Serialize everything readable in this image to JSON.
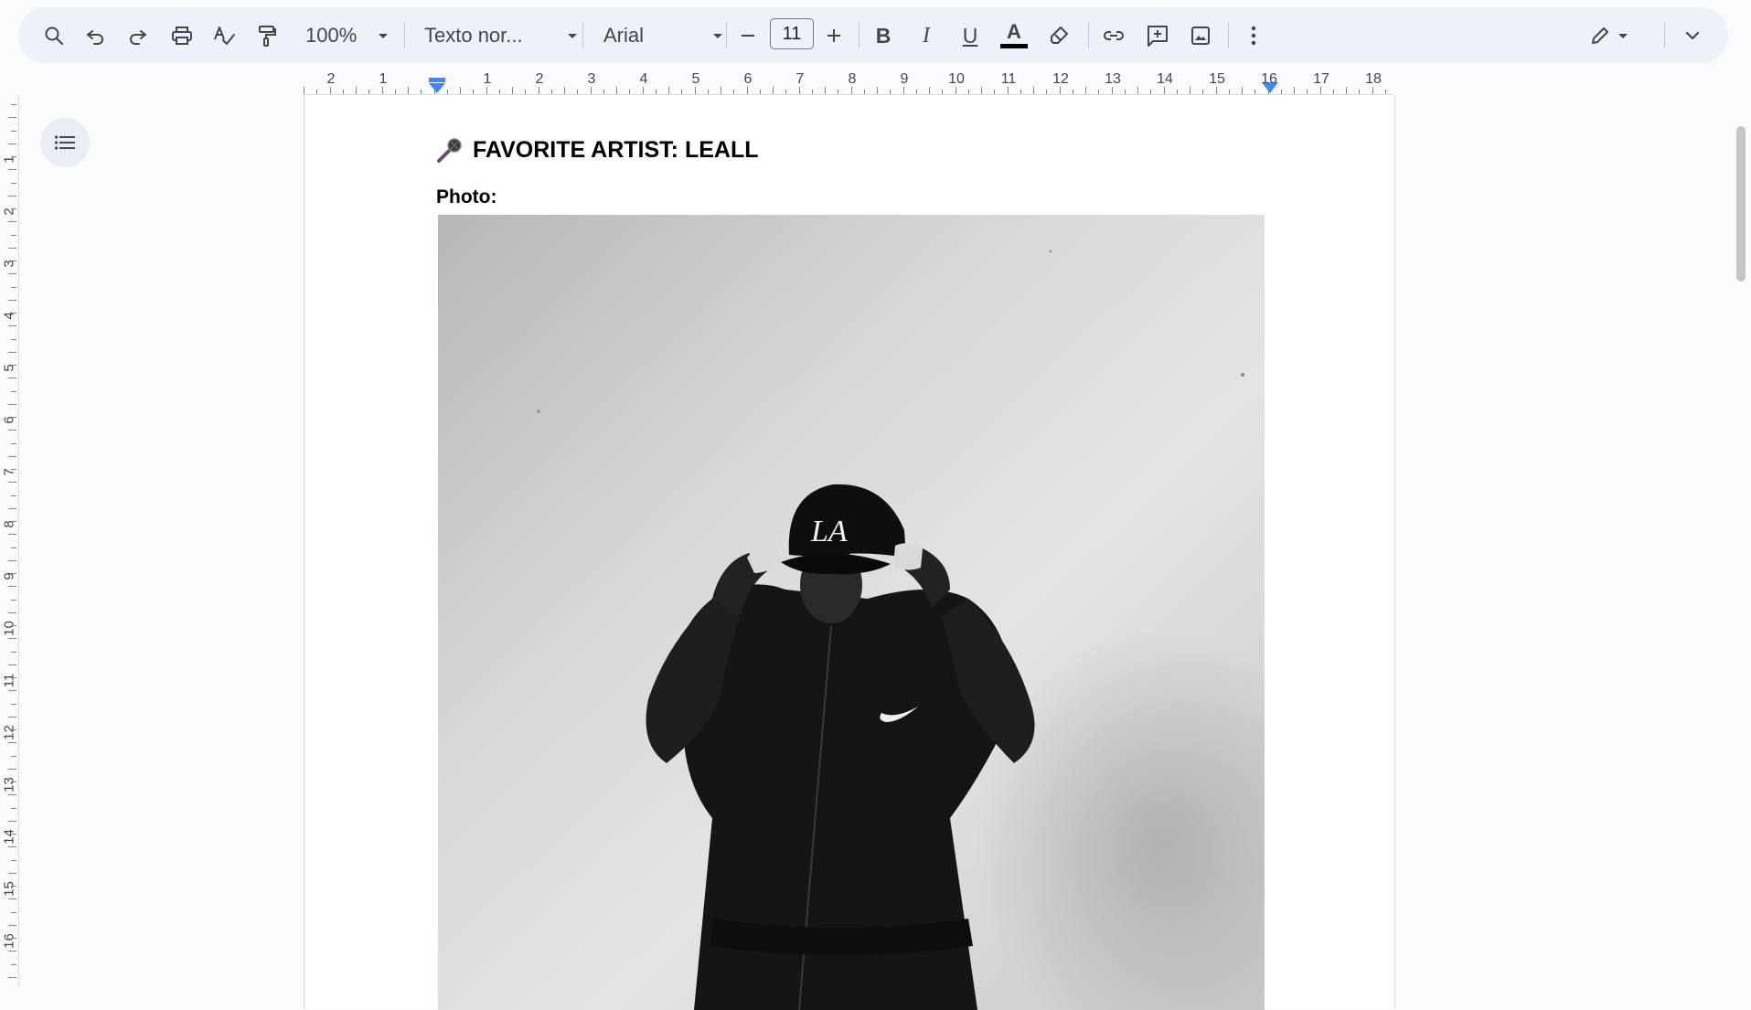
{
  "toolbar": {
    "zoom": "100%",
    "style": "Texto nor...",
    "font": "Arial",
    "font_size": "11",
    "bold_label": "B",
    "italic_label": "I",
    "underline_label": "U",
    "text_color_label": "A",
    "text_color": "#000000",
    "icons": [
      "search-icon",
      "undo-icon",
      "redo-icon",
      "print-icon",
      "spellcheck-icon",
      "paint-format-icon",
      "minus-icon",
      "plus-icon",
      "text-color-icon",
      "highlighter-icon",
      "link-icon",
      "add-comment-icon",
      "insert-image-icon",
      "more-vert-icon",
      "edit-mode-icon",
      "collapse-icon"
    ]
  },
  "ruler": {
    "horizontal_numbers": [
      "2",
      "1",
      "1",
      "2",
      "3",
      "4",
      "5",
      "6",
      "7",
      "8",
      "9",
      "10",
      "11",
      "12",
      "13",
      "14",
      "15",
      "16",
      "17",
      "18"
    ],
    "vertical_numbers": [
      "1",
      "2",
      "3",
      "4",
      "5",
      "6",
      "7",
      "8",
      "9",
      "10",
      "11",
      "12",
      "13",
      "14",
      "15",
      "16"
    ]
  },
  "document": {
    "title": "FAVORITE ARTIST: LEALL",
    "photo_label": "Photo:",
    "cap_logo": "LA"
  },
  "colors": {
    "toolbar_bg": "#edf2fa",
    "app_bg": "#f9fbfd",
    "ruler_marker": "#4285f4",
    "mic_icon": "#6b4a6e"
  }
}
